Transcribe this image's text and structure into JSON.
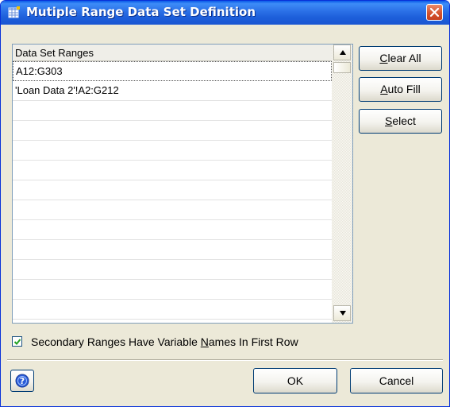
{
  "window": {
    "title": "Mutiple Range Data Set Definition"
  },
  "list": {
    "header": "Data Set Ranges",
    "rows": [
      "A12:G303",
      "'Loan Data 2'!A2:G212",
      "",
      "",
      "",
      "",
      "",
      "",
      "",
      "",
      "",
      "",
      ""
    ]
  },
  "buttons": {
    "clear_all": {
      "mnemonic": "C",
      "rest": "lear All"
    },
    "auto_fill": {
      "mnemonic": "A",
      "rest": "uto Fill"
    },
    "select": {
      "mnemonic": "S",
      "rest": "elect"
    },
    "ok": "OK",
    "cancel": "Cancel"
  },
  "checkbox": {
    "checked": true,
    "label_pre": "Secondary Ranges Have Variable ",
    "label_mnemonic": "N",
    "label_post": "ames In First Row"
  },
  "colors": {
    "title_bar": "#2a6fe6",
    "dialog_bg": "#ece9d8",
    "close_button": "#d4532e",
    "help_icon": "#2a5bd7"
  },
  "icons": {
    "app": "table-grid-icon",
    "close": "close-icon",
    "scroll_up": "arrow-up-icon",
    "scroll_down": "arrow-down-icon",
    "help": "help-icon"
  }
}
